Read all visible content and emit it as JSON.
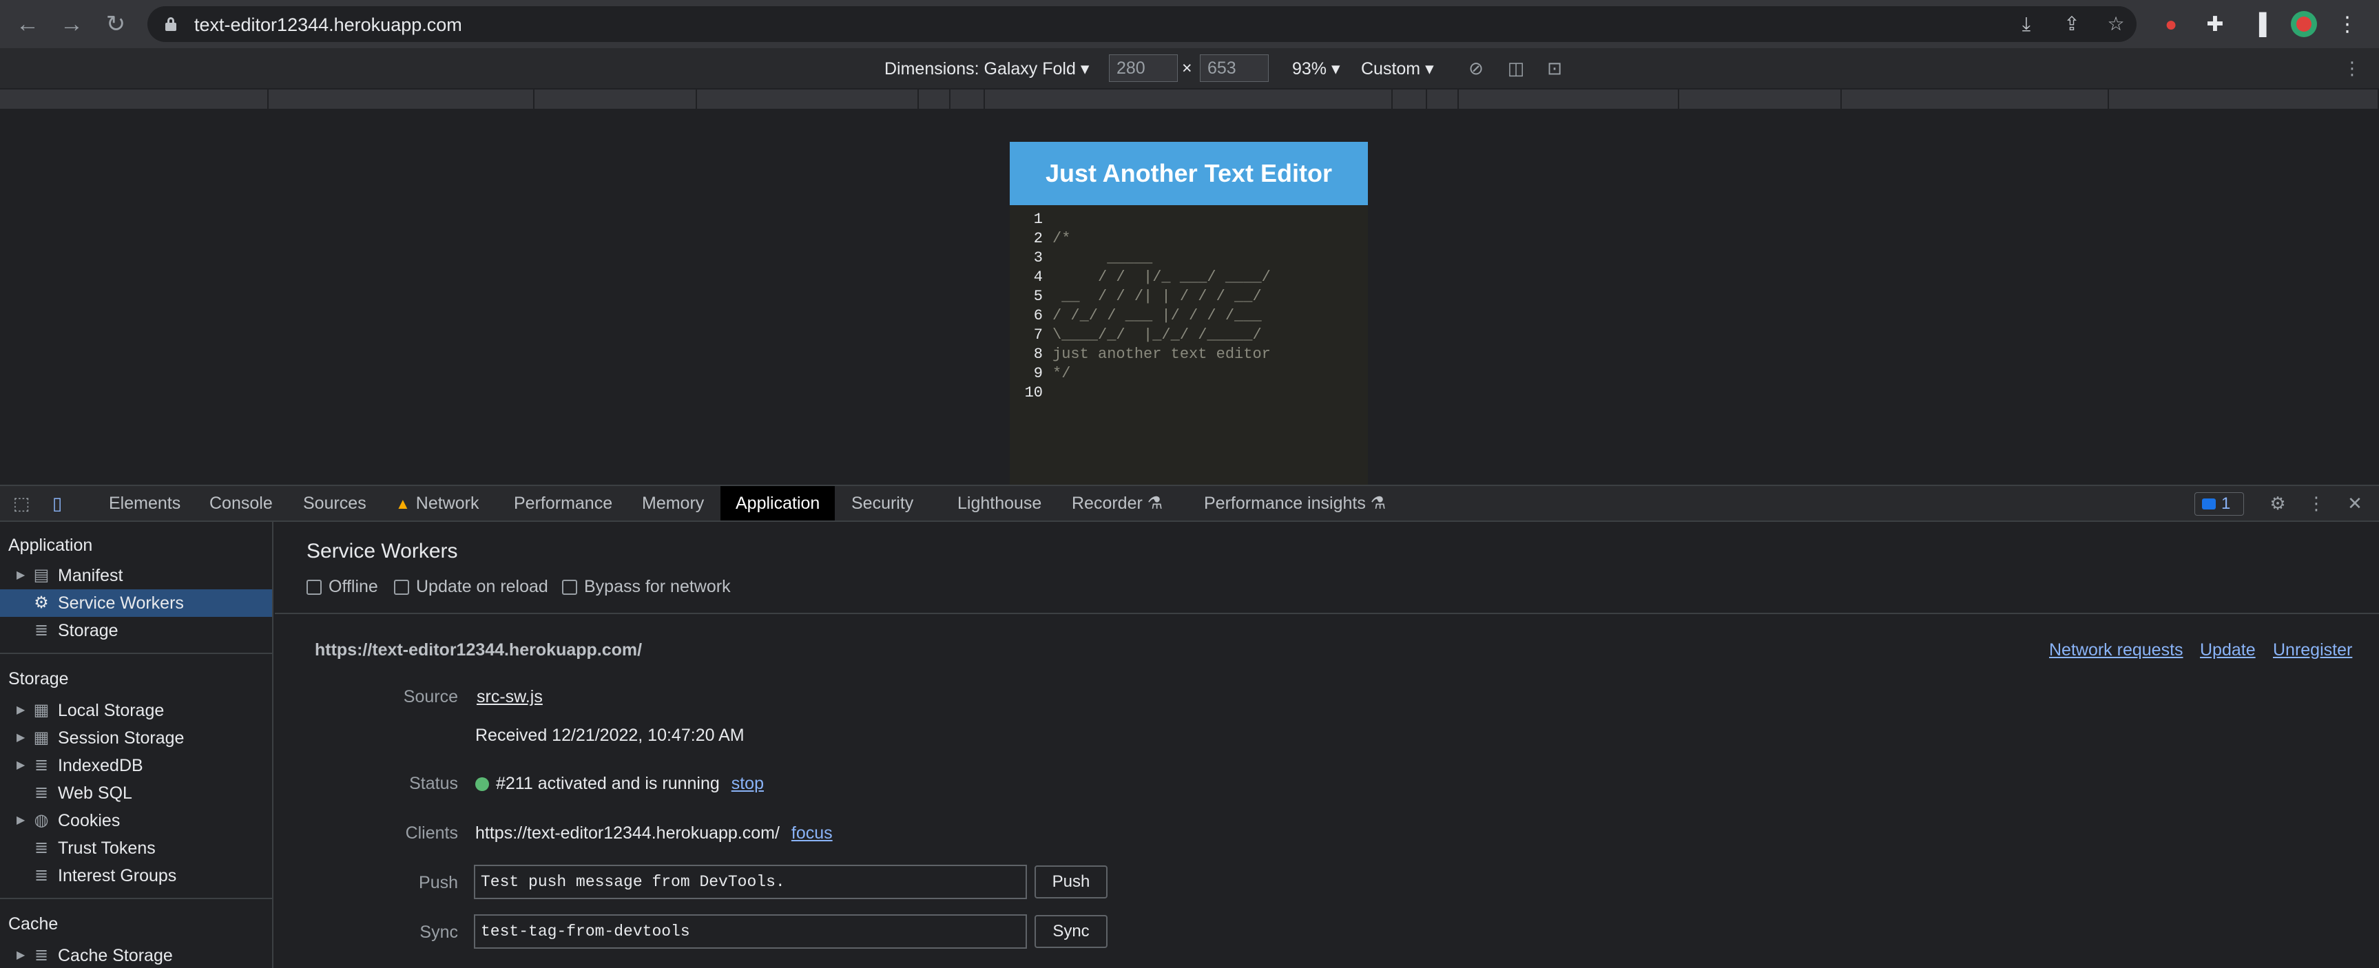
{
  "browser": {
    "url": "text-editor12344.herokuapp.com"
  },
  "device_toolbar": {
    "dimensions_label": "Dimensions: Galaxy Fold",
    "width": "280",
    "times": "×",
    "height": "653",
    "zoom": "93%",
    "throttle": "Custom"
  },
  "app": {
    "title": "Just Another Text Editor",
    "lines": [
      {
        "n": "1",
        "text": ""
      },
      {
        "n": "2",
        "text": "/*"
      },
      {
        "n": "3",
        "text": "      _____"
      },
      {
        "n": "4",
        "text": "     / /  |/_ ___/ ____/"
      },
      {
        "n": "5",
        "text": " __  / / /| | / / / __/"
      },
      {
        "n": "6",
        "text": "/ /_/ / ___ |/ / / /___"
      },
      {
        "n": "7",
        "text": "\\____/_/  |_/_/ /_____/"
      },
      {
        "n": "8",
        "text": "just another text editor"
      },
      {
        "n": "9",
        "text": "*/"
      },
      {
        "n": "10",
        "text": ""
      }
    ]
  },
  "devtools": {
    "tabs": [
      "Elements",
      "Console",
      "Sources",
      "Network",
      "Performance",
      "Memory",
      "Application",
      "Security",
      "Lighthouse",
      "Recorder",
      "Performance insights"
    ],
    "issues_count": "1",
    "sidebar": {
      "application_heading": "Application",
      "application_items": [
        "Manifest",
        "Service Workers",
        "Storage"
      ],
      "storage_heading": "Storage",
      "storage_items": [
        "Local Storage",
        "Session Storage",
        "IndexedDB",
        "Web SQL",
        "Cookies",
        "Trust Tokens",
        "Interest Groups"
      ],
      "cache_heading": "Cache",
      "cache_items": [
        "Cache Storage"
      ]
    },
    "panel": {
      "title": "Service Workers",
      "checkboxes": [
        "Offline",
        "Update on reload",
        "Bypass for network"
      ],
      "origin": "https://text-editor12344.herokuapp.com/",
      "origin_actions": [
        "Network requests",
        "Update",
        "Unregister"
      ],
      "source_label": "Source",
      "source_file": "src-sw.js",
      "received": "Received 12/21/2022, 10:47:20 AM",
      "status_label": "Status",
      "status_text": "#211 activated and is running",
      "status_action": "stop",
      "clients_label": "Clients",
      "clients_value": "https://text-editor12344.herokuapp.com/",
      "clients_action": "focus",
      "push_label": "Push",
      "push_value": "Test push message from DevTools.",
      "push_button": "Push",
      "sync_label": "Sync",
      "sync_value": "test-tag-from-devtools",
      "sync_button": "Sync"
    }
  },
  "colors": {
    "app_header": "#4aa3df",
    "selected_row": "#2a4f7c",
    "link": "#8ab4f8",
    "status_ok": "#5bb974"
  }
}
